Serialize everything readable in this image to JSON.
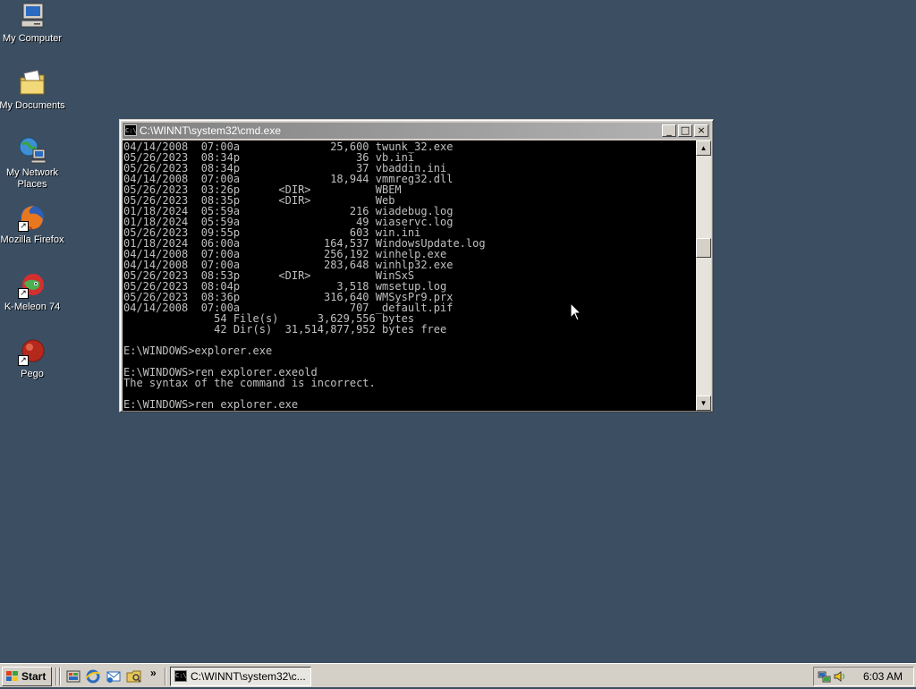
{
  "desktop": {
    "icons": [
      {
        "label": "My Computer",
        "icon": "my-computer-icon"
      },
      {
        "label": "My Documents",
        "icon": "my-documents-icon"
      },
      {
        "label": "My Network Places",
        "icon": "network-places-icon"
      },
      {
        "label": "Mozilla Firefox",
        "icon": "firefox-icon"
      },
      {
        "label": "K-Meleon 74",
        "icon": "k-meleon-icon"
      },
      {
        "label": "Pego",
        "icon": "pego-icon"
      }
    ]
  },
  "window": {
    "title": "C:\\WINNT\\system32\\cmd.exe",
    "icon_text": "C:\\",
    "minimize_glyph": "_",
    "maximize_glyph": "□",
    "close_glyph": "×",
    "console_lines": [
      "04/14/2008  07:00a              25,600 twunk_32.exe",
      "05/26/2023  08:34p                  36 vb.ini",
      "05/26/2023  08:34p                  37 vbaddin.ini",
      "04/14/2008  07:00a              18,944 vmmreg32.dll",
      "05/26/2023  03:26p      <DIR>          WBEM",
      "05/26/2023  08:35p      <DIR>          Web",
      "01/18/2024  05:59a                 216 wiadebug.log",
      "01/18/2024  05:59a                  49 wiaservc.log",
      "05/26/2023  09:55p                 603 win.ini",
      "01/18/2024  06:00a             164,537 WindowsUpdate.log",
      "04/14/2008  07:00a             256,192 winhelp.exe",
      "04/14/2008  07:00a             283,648 winhlp32.exe",
      "05/26/2023  08:53p      <DIR>          WinSxS",
      "05/26/2023  08:04p               3,518 wmsetup.log",
      "05/26/2023  08:36p             316,640 WMSysPr9.prx",
      "04/14/2008  07:00a                 707 _default.pif",
      "              54 File(s)      3,629,556 bytes",
      "              42 Dir(s)  31,514,877,952 bytes free",
      "",
      "E:\\WINDOWS>explorer.exe",
      "",
      "E:\\WINDOWS>ren explorer.exeold",
      "The syntax of the command is incorrect.",
      "",
      "E:\\WINDOWS>ren explorer.exe"
    ]
  },
  "taskbar": {
    "start_label": "Start",
    "quick_launch": [
      "show-desktop-icon",
      "ie-icon",
      "outlook-icon",
      "explorer-icon"
    ],
    "chevron": "»",
    "task_label": "C:\\WINNT\\system32\\c...",
    "task_icon_text": "C:\\",
    "clock": "6:03 AM",
    "tray_icons": [
      "network-tray-icon",
      "volume-tray-icon"
    ]
  }
}
